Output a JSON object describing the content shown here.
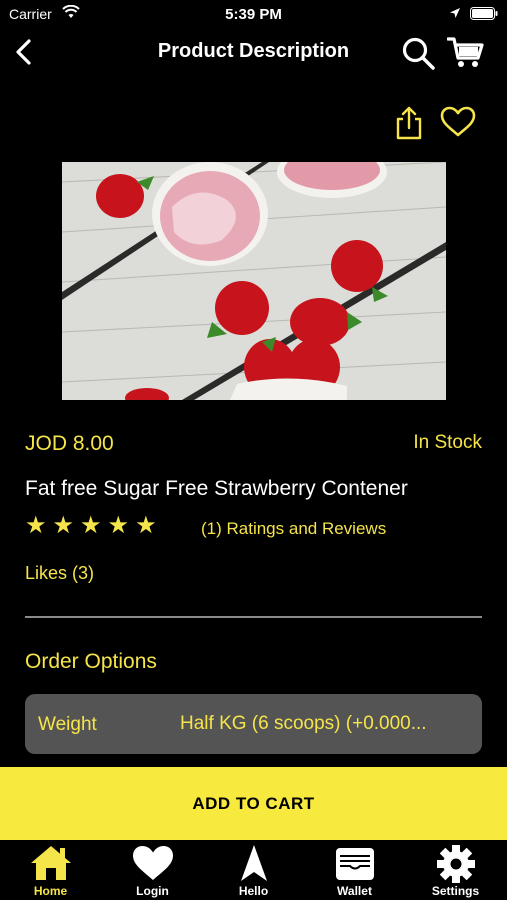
{
  "status": {
    "carrier": "Carrier",
    "time": "5:39 PM"
  },
  "nav": {
    "title": "Product Description"
  },
  "product": {
    "price": "JOD 8.00",
    "stock": "In Stock",
    "name": "Fat free Sugar Free Strawberry Contener",
    "stars": "★★★★★",
    "rating_count_text": "(1) Ratings and Reviews",
    "likes": "Likes (3)"
  },
  "order": {
    "title": "Order Options",
    "option_label": "Weight",
    "option_value": "Half KG  (6 scoops) (+0.000..."
  },
  "cta": {
    "add_to_cart": "ADD TO CART"
  },
  "tabs": [
    {
      "label": "Home",
      "icon": "home-icon"
    },
    {
      "label": "Login",
      "icon": "heart-icon"
    },
    {
      "label": "Hello",
      "icon": "navigation-arrow-icon"
    },
    {
      "label": "Wallet",
      "icon": "wallet-icon"
    },
    {
      "label": "Settings",
      "icon": "gear-icon"
    }
  ],
  "colors": {
    "accent": "#f5e44a",
    "button": "#f7e93e",
    "background": "#000000",
    "option_bg": "#545454"
  }
}
